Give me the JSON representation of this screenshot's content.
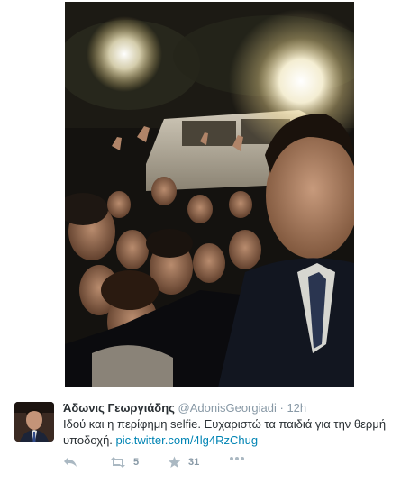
{
  "tweet": {
    "display_name": "Άδωνις Γεωργιάδης",
    "handle": "@AdonisGeorgiadi",
    "separator": "·",
    "time": "12h",
    "text": "Ιδού και η περίφημη selfie. Ευχαριστώ τα παιδιά για την θερμή υποδοχή.",
    "link": "pic.twitter.com/4lg4RzChug"
  },
  "actions": {
    "reply_icon": "reply-icon",
    "retweet_icon": "retweet-icon",
    "retweet_count": "5",
    "favorite_icon": "star-icon",
    "favorite_count": "31",
    "more_icon": "more-icon"
  },
  "colors": {
    "link": "#0084b4",
    "name": "#292f33",
    "meta": "#8899a6"
  }
}
